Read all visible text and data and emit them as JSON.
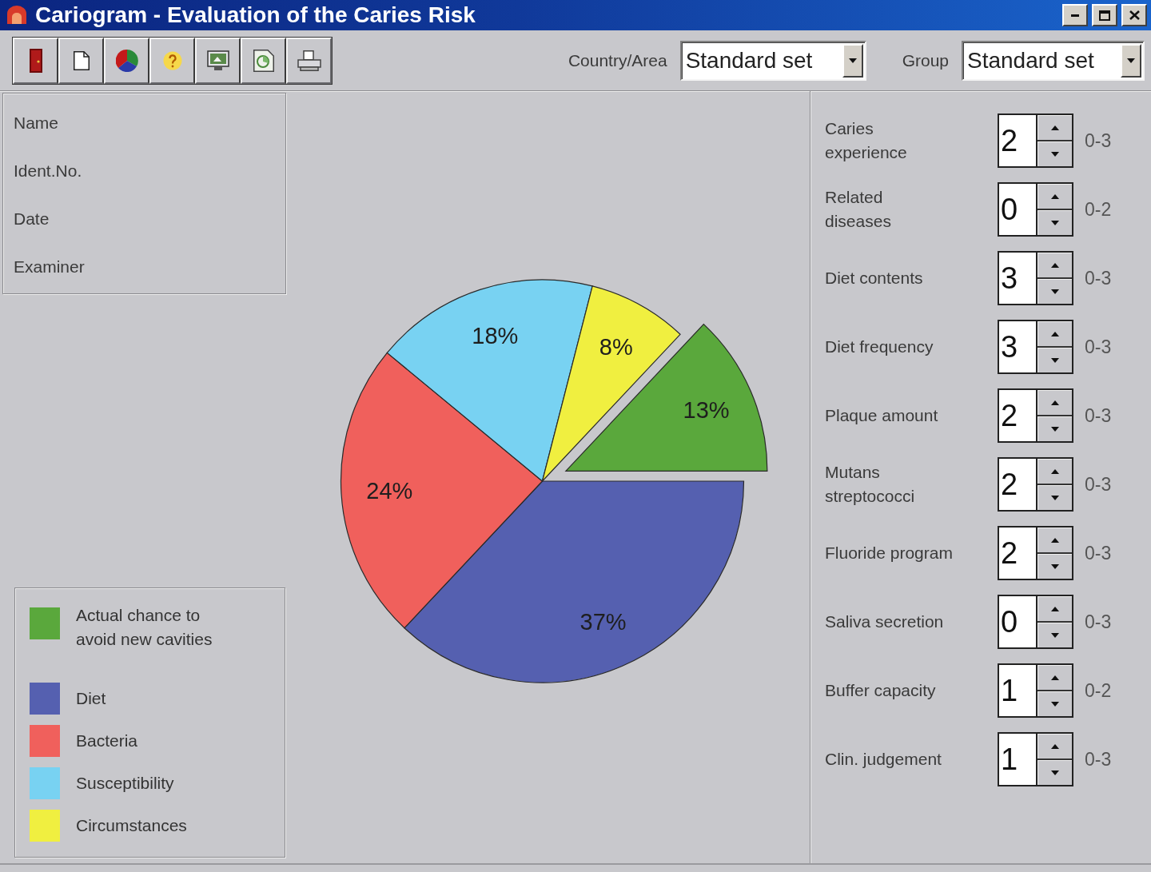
{
  "window": {
    "title": "Cariogram - Evaluation of the Caries Risk"
  },
  "toolbar": {
    "country_area": {
      "label": "Country/Area",
      "value": "Standard set"
    },
    "group": {
      "label": "Group",
      "value": "Standard set"
    }
  },
  "patient_info": {
    "fields": [
      "Name",
      "Ident.No.",
      "Date",
      "Examiner"
    ]
  },
  "chart": {
    "slices": [
      {
        "exploded": true
      },
      {
        "exploded": false
      },
      {
        "exploded": false
      },
      {
        "exploded": false
      },
      {
        "exploded": false
      }
    ],
    "chart_data": {
      "type": "pie",
      "values": [
        13,
        37,
        24,
        18,
        8
      ],
      "value_labels": [
        "13%",
        "37%",
        "24%",
        "18%",
        "8%"
      ]
    }
  },
  "legend": {
    "items": [
      {
        "label": "Actual chance to\navoid new cavities",
        "color": "#5aa83c"
      },
      {
        "label": "Diet",
        "color": "#5560b0"
      },
      {
        "label": "Bacteria",
        "color": "#f0605c"
      },
      {
        "label": "Susceptibility",
        "color": "#78d2f2"
      },
      {
        "label": "Circumstances",
        "color": "#f0ef40"
      }
    ]
  },
  "factors": [
    {
      "label": "Caries\nexperience",
      "value": "2",
      "range": "0-3"
    },
    {
      "label": "Related\ndiseases",
      "value": "0",
      "range": "0-2"
    },
    {
      "label": "Diet contents",
      "value": "3",
      "range": "0-3"
    },
    {
      "label": "Diet frequency",
      "value": "3",
      "range": "0-3"
    },
    {
      "label": "Plaque amount",
      "value": "2",
      "range": "0-3"
    },
    {
      "label": "Mutans\nstreptococci",
      "value": "2",
      "range": "0-3"
    },
    {
      "label": "Fluoride program",
      "value": "2",
      "range": "0-3"
    },
    {
      "label": "Saliva secretion",
      "value": "0",
      "range": "0-3"
    },
    {
      "label": "Buffer capacity",
      "value": "1",
      "range": "0-2"
    },
    {
      "label": "Clin. judgement",
      "value": "1",
      "range": "0-3"
    }
  ]
}
